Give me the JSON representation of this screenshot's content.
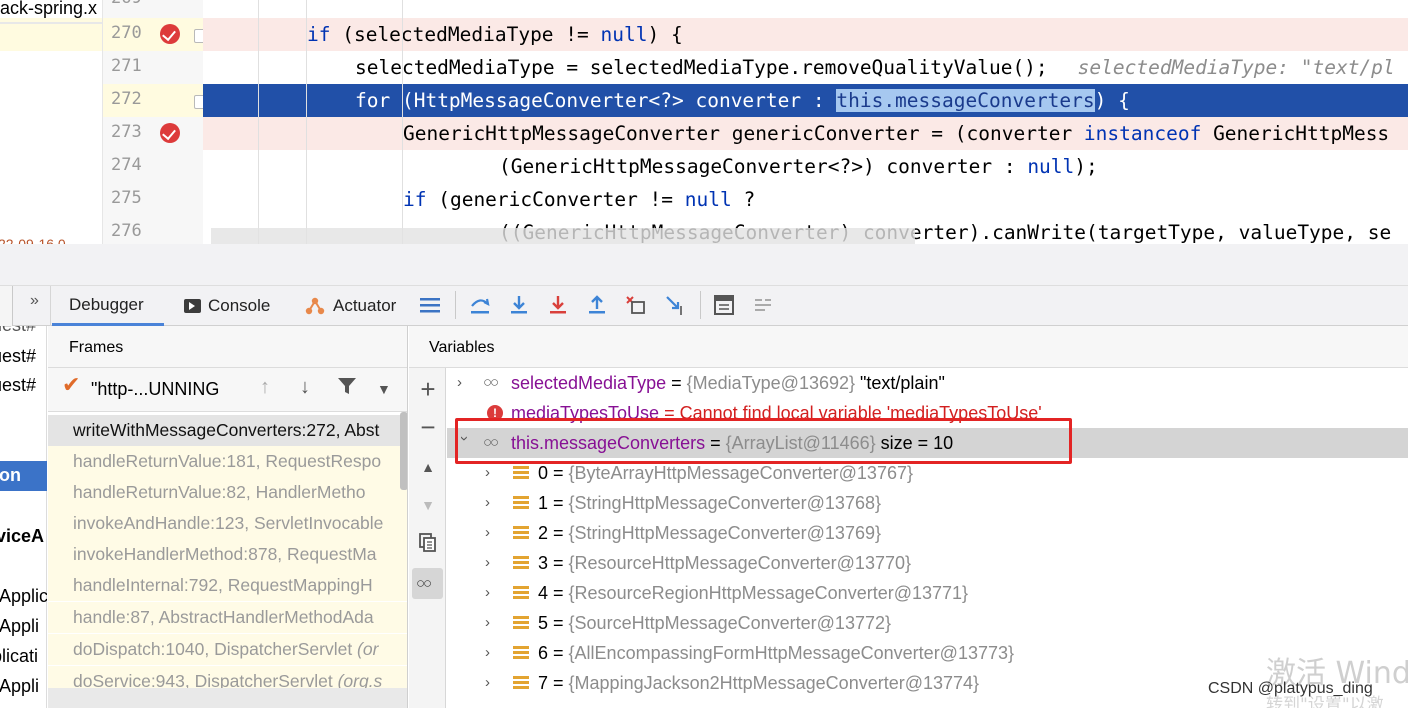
{
  "left_panel": {
    "tab_label": "ack-spring.x",
    "timestamp": "22-09-16 0"
  },
  "editor": {
    "lines": [
      {
        "num": "269",
        "code": ""
      },
      {
        "num": "270",
        "breakpoint": true
      },
      {
        "num": "271"
      },
      {
        "num": "272",
        "current": true
      },
      {
        "num": "273",
        "breakpoint": true
      },
      {
        "num": "274"
      },
      {
        "num": "275"
      },
      {
        "num": "276"
      }
    ],
    "l270_kw1": "if",
    "l270_rest": " (selectedMediaType != ",
    "l270_null": "null",
    "l270_end": ") {",
    "l271_code": "selectedMediaType = selectedMediaType.removeQualityValue();",
    "l271_hint": "selectedMediaType: \"text/pl",
    "l272_for": "for",
    "l272_mid": " (HttpMessageConverter<?> converter : ",
    "l272_sel": "this.messageConverters",
    "l272_end": ") {",
    "l273_a": "GenericHttpMessageConverter genericConverter = (converter ",
    "l273_kw": "instanceof",
    "l273_b": " GenericHttpMess",
    "l274_a": "(GenericHttpMessageConverter<?>) converter : ",
    "l274_null": "null",
    "l274_b": ");",
    "l275_kw": "if",
    "l275_a": " (genericConverter != ",
    "l275_null": "null",
    "l275_b": " ?",
    "l276_code": "((GenericHttpMessageConverter) converter).canWrite(targetType, valueType, se"
  },
  "toolbar": {
    "more": "»",
    "tabs": [
      "Debugger",
      "Console",
      "Actuator"
    ]
  },
  "project_items": [
    "uest#",
    "uest#",
    "uest#",
    "on",
    "viceA",
    "Applic",
    "Appli",
    "plicati",
    "Appli"
  ],
  "frames": {
    "title": "Frames",
    "thread": "\"http-...UNNING",
    "rows": [
      {
        "method": "writeWithMessageConverters:272, Abst",
        "cls": ""
      },
      {
        "method": "handleReturnValue:181, RequestRespo",
        "cls": ""
      },
      {
        "method": "handleReturnValue:82, HandlerMetho",
        "cls": ""
      },
      {
        "method": "invokeAndHandle:123, ServletInvocable",
        "cls": ""
      },
      {
        "method": "invokeHandlerMethod:878, RequestMa",
        "cls": ""
      },
      {
        "method": "handleInternal:792, RequestMappingH",
        "cls": ""
      },
      {
        "method": "handle:87, AbstractHandlerMethodAda",
        "cls": ""
      },
      {
        "method": "doDispatch:1040, DispatcherServlet ",
        "cls": "(or"
      },
      {
        "method": "doService:943, DispatcherServlet ",
        "cls": "(org.s"
      }
    ]
  },
  "variables": {
    "title": "Variables",
    "v0": {
      "name": "selectedMediaType",
      "eq": " = ",
      "type": "{MediaType@13692}",
      "value": " \"text/plain\""
    },
    "v1": {
      "name": "mediaTypesToUse",
      "eq": " = ",
      "error": "Cannot find local variable 'mediaTypesToUse'"
    },
    "v2": {
      "name": "this.messageConverters",
      "eq": " = ",
      "type": "{ArrayList@11466}",
      "value": "  size = 10"
    },
    "items": [
      {
        "idx": "0",
        "eq": " = ",
        "type": "{ByteArrayHttpMessageConverter@13767}"
      },
      {
        "idx": "1",
        "eq": " = ",
        "type": "{StringHttpMessageConverter@13768}"
      },
      {
        "idx": "2",
        "eq": " = ",
        "type": "{StringHttpMessageConverter@13769}"
      },
      {
        "idx": "3",
        "eq": " = ",
        "type": "{ResourceHttpMessageConverter@13770}"
      },
      {
        "idx": "4",
        "eq": " = ",
        "type": "{ResourceRegionHttpMessageConverter@13771}"
      },
      {
        "idx": "5",
        "eq": " = ",
        "type": "{SourceHttpMessageConverter@13772}"
      },
      {
        "idx": "6",
        "eq": " = ",
        "type": "{AllEncompassingFormHttpMessageConverter@13773}"
      },
      {
        "idx": "7",
        "eq": " = ",
        "type": "{MappingJackson2HttpMessageConverter@13774}"
      }
    ]
  },
  "watermarks": {
    "windows": "激活 Wind",
    "windows_sub": "转到\"设置\"以激",
    "csdn": "CSDN @platypus_ding"
  },
  "colors": {
    "current_line": "#2150a8",
    "breakpoint": "#dd3b3b",
    "highlight_box": "#e32424"
  }
}
